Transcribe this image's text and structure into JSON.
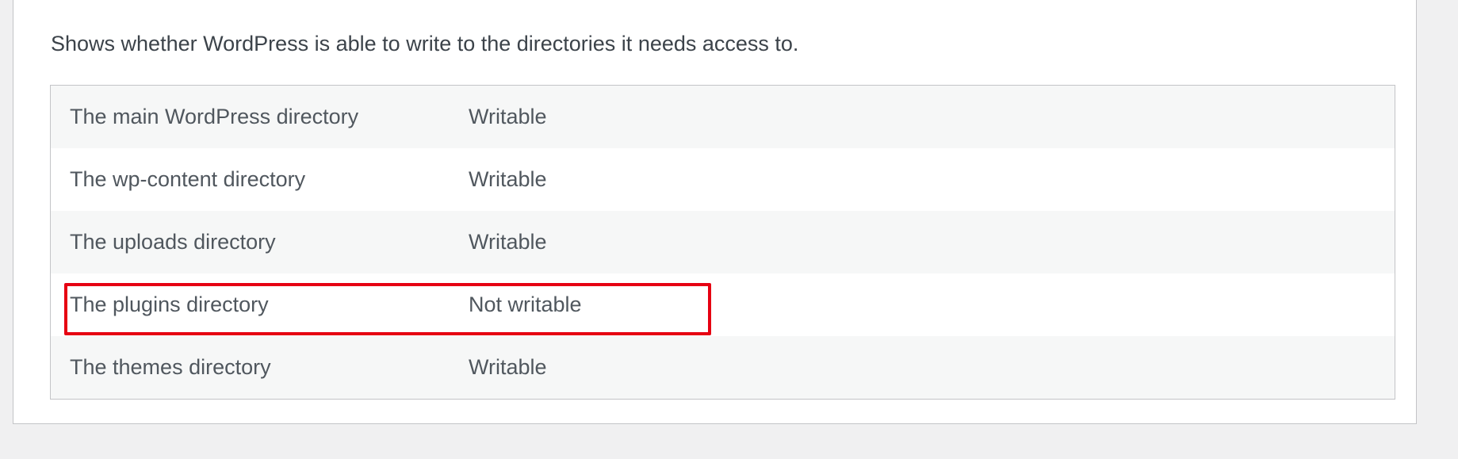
{
  "section": {
    "description": "Shows whether WordPress is able to write to the directories it needs access to."
  },
  "directories": {
    "rows": [
      {
        "label": "The main WordPress directory",
        "value": "Writable"
      },
      {
        "label": "The wp-content directory",
        "value": "Writable"
      },
      {
        "label": "The uploads directory",
        "value": "Writable"
      },
      {
        "label": "The plugins directory",
        "value": "Not writable"
      },
      {
        "label": "The themes directory",
        "value": "Writable"
      }
    ]
  },
  "annotation": {
    "highlight_color": "#e60012",
    "highlighted_row": "The plugins directory"
  }
}
